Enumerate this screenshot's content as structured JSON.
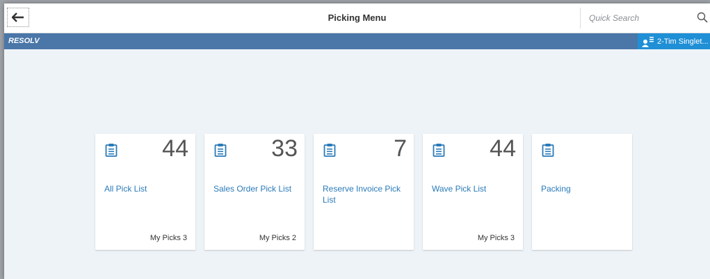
{
  "header": {
    "title": "Picking Menu",
    "back_icon": "arrow-left-icon",
    "search": {
      "placeholder": "Quick Search",
      "value": "",
      "icon": "search-icon"
    }
  },
  "subheader": {
    "brand": "RESOLV",
    "user": {
      "name": "2-Tim Singlet...",
      "icon": "user-list-icon"
    },
    "colors": {
      "bar": "#4a76a8",
      "user_button": "#1f8fd6"
    }
  },
  "tiles": [
    {
      "title": "All Pick List",
      "count": "44",
      "footer": "My Picks 3",
      "icon": "clipboard-icon"
    },
    {
      "title": "Sales Order Pick List",
      "count": "33",
      "footer": "My Picks 2",
      "icon": "clipboard-icon"
    },
    {
      "title": "Reserve Invoice Pick List",
      "count": "7",
      "footer": "",
      "icon": "clipboard-icon"
    },
    {
      "title": "Wave Pick List",
      "count": "44",
      "footer": "My Picks 3",
      "icon": "clipboard-icon"
    },
    {
      "title": "Packing",
      "count": "",
      "footer": "",
      "icon": "clipboard-icon"
    }
  ],
  "colors": {
    "tile_title": "#2a7ab8",
    "background": "#eef3f7"
  }
}
